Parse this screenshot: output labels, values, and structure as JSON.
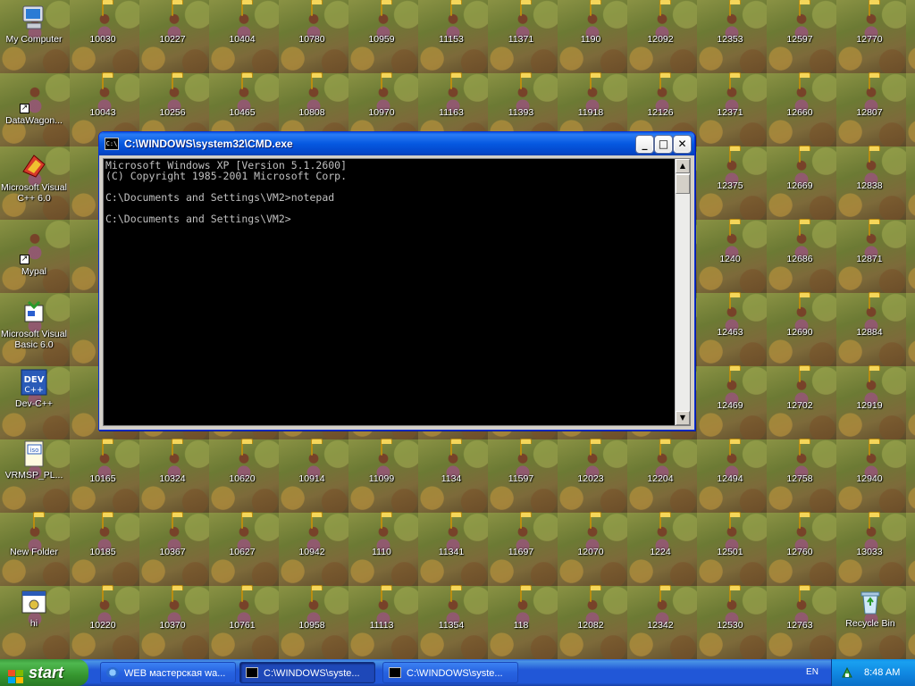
{
  "desktop": {
    "system_icons": [
      {
        "name": "my-computer",
        "label": "My Computer"
      },
      {
        "name": "datawagon",
        "label": "DataWagon..."
      },
      {
        "name": "visual-cpp",
        "label": "Microsoft Visual C++ 6.0"
      },
      {
        "name": "mypal",
        "label": "Mypal"
      },
      {
        "name": "visual-basic",
        "label": "Microsoft Visual Basic 6.0"
      },
      {
        "name": "dev-cpp",
        "label": "Dev-C++"
      },
      {
        "name": "vrmsp",
        "label": "VRMSP_PL..."
      },
      {
        "name": "new-folder",
        "label": "New Folder"
      },
      {
        "name": "hi",
        "label": "hi"
      },
      {
        "name": "recycle-bin",
        "label": "Recycle Bin"
      }
    ],
    "folders": [
      [
        "10030",
        "10227",
        "10404",
        "10780",
        "10959",
        "11153",
        "11371",
        "1190",
        "12092",
        "12353",
        "12597",
        "12770"
      ],
      [
        "10043",
        "10256",
        "10465",
        "10808",
        "10970",
        "11163",
        "11393",
        "11918",
        "12126",
        "12371",
        "12660",
        "12807"
      ],
      [
        "12375",
        "12669",
        "12838"
      ],
      [
        "1240",
        "12686",
        "12871"
      ],
      [
        "12463",
        "12690",
        "12884"
      ],
      [
        "12469",
        "12702",
        "12919"
      ],
      [
        "10165",
        "10324",
        "10620",
        "10914",
        "11099",
        "1134",
        "11597",
        "12023",
        "12204",
        "12494",
        "12758",
        "12940"
      ],
      [
        "10185",
        "10367",
        "10627",
        "10942",
        "1110",
        "11341",
        "11697",
        "12070",
        "1224",
        "12501",
        "12760",
        "13033"
      ],
      [
        "10220",
        "10370",
        "10761",
        "10958",
        "11113",
        "11354",
        "118",
        "12082",
        "12342",
        "12530",
        "12763"
      ]
    ]
  },
  "cmd_window": {
    "title": "C:\\WINDOWS\\system32\\CMD.exe",
    "icon": "cmd-icon",
    "buttons": {
      "minimize": "_",
      "maximize": "□",
      "close": "✕"
    },
    "console_text": "Microsoft Windows XP [Version 5.1.2600]\n(C) Copyright 1985-2001 Microsoft Corp.\n\nC:\\Documents and Settings\\VM2>notepad\n\nC:\\Documents and Settings\\VM2>"
  },
  "taskbar": {
    "start_label": "start",
    "items": [
      {
        "label": "WEB мастерская wa...",
        "icon": "ie-icon",
        "active": false
      },
      {
        "label": "C:\\WINDOWS\\syste...",
        "icon": "cmd-icon",
        "active": true
      },
      {
        "label": "C:\\WINDOWS\\syste...",
        "icon": "cmd-icon",
        "active": false
      }
    ],
    "language": "EN",
    "clock": "8:48 AM"
  }
}
